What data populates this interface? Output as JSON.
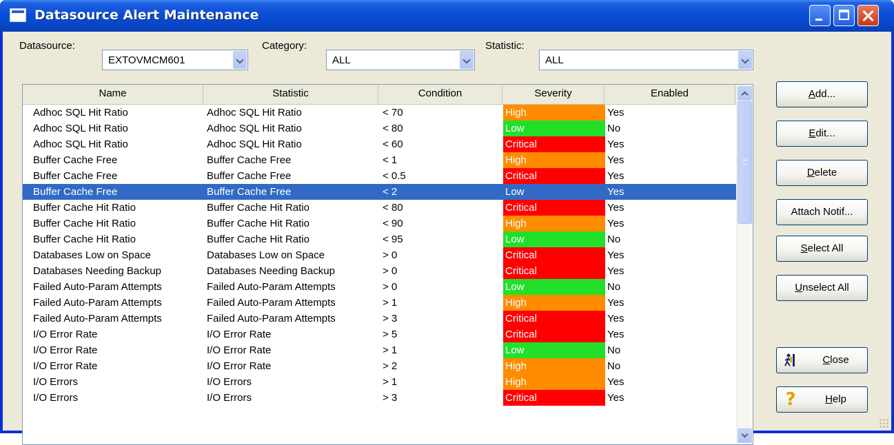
{
  "window": {
    "title": "Datasource Alert Maintenance"
  },
  "filters": {
    "datasource_label": "Datasource:",
    "datasource_value": "EXTOVMCM601",
    "category_label": "Category:",
    "category_value": "ALL",
    "statistic_label": "Statistic:",
    "statistic_value": "ALL"
  },
  "columns": [
    "Name",
    "Statistic",
    "Condition",
    "Severity",
    "Enabled"
  ],
  "rows": [
    {
      "name": "Adhoc SQL Hit Ratio",
      "statistic": "Adhoc SQL Hit Ratio",
      "condition": "< 70",
      "severity": "High",
      "enabled": "Yes"
    },
    {
      "name": "Adhoc SQL Hit Ratio",
      "statistic": "Adhoc SQL Hit Ratio",
      "condition": "< 80",
      "severity": "Low",
      "enabled": "No"
    },
    {
      "name": "Adhoc SQL Hit Ratio",
      "statistic": "Adhoc SQL Hit Ratio",
      "condition": "< 60",
      "severity": "Critical",
      "enabled": "Yes"
    },
    {
      "name": "Buffer Cache Free",
      "statistic": "Buffer Cache Free",
      "condition": "< 1",
      "severity": "High",
      "enabled": "Yes"
    },
    {
      "name": "Buffer Cache Free",
      "statistic": "Buffer Cache Free",
      "condition": "< 0.5",
      "severity": "Critical",
      "enabled": "Yes"
    },
    {
      "name": "Buffer Cache Free",
      "statistic": "Buffer Cache Free",
      "condition": "< 2",
      "severity": "Low",
      "enabled": "Yes",
      "selected": true
    },
    {
      "name": "Buffer Cache Hit Ratio",
      "statistic": "Buffer Cache Hit Ratio",
      "condition": "< 80",
      "severity": "Critical",
      "enabled": "Yes"
    },
    {
      "name": "Buffer Cache Hit Ratio",
      "statistic": "Buffer Cache Hit Ratio",
      "condition": "< 90",
      "severity": "High",
      "enabled": "Yes"
    },
    {
      "name": "Buffer Cache Hit Ratio",
      "statistic": "Buffer Cache Hit Ratio",
      "condition": "< 95",
      "severity": "Low",
      "enabled": "No"
    },
    {
      "name": "Databases Low on Space",
      "statistic": "Databases Low on Space",
      "condition": "> 0",
      "severity": "Critical",
      "enabled": "Yes"
    },
    {
      "name": "Databases Needing Backup",
      "statistic": "Databases Needing Backup",
      "condition": "> 0",
      "severity": "Critical",
      "enabled": "Yes"
    },
    {
      "name": "Failed Auto-Param Attempts",
      "statistic": "Failed Auto-Param Attempts",
      "condition": "> 0",
      "severity": "Low",
      "enabled": "No"
    },
    {
      "name": "Failed Auto-Param Attempts",
      "statistic": "Failed Auto-Param Attempts",
      "condition": "> 1",
      "severity": "High",
      "enabled": "Yes"
    },
    {
      "name": "Failed Auto-Param Attempts",
      "statistic": "Failed Auto-Param Attempts",
      "condition": "> 3",
      "severity": "Critical",
      "enabled": "Yes"
    },
    {
      "name": "I/O Error Rate",
      "statistic": "I/O Error Rate",
      "condition": "> 5",
      "severity": "Critical",
      "enabled": "Yes"
    },
    {
      "name": "I/O Error Rate",
      "statistic": "I/O Error Rate",
      "condition": "> 1",
      "severity": "Low",
      "enabled": "No"
    },
    {
      "name": "I/O Error Rate",
      "statistic": "I/O Error Rate",
      "condition": "> 2",
      "severity": "High",
      "enabled": "No"
    },
    {
      "name": "I/O Errors",
      "statistic": "I/O Errors",
      "condition": "> 1",
      "severity": "High",
      "enabled": "Yes"
    },
    {
      "name": "I/O Errors",
      "statistic": "I/O Errors",
      "condition": "> 3",
      "severity": "Critical",
      "enabled": "Yes"
    }
  ],
  "buttons": {
    "add": {
      "hot": "A",
      "rest": "dd..."
    },
    "edit": {
      "hot": "E",
      "rest": "dit..."
    },
    "delete": {
      "hot": "D",
      "rest": "elete"
    },
    "attach": {
      "label": "Attach Notif..."
    },
    "select_all": {
      "hot": "S",
      "rest": "elect All"
    },
    "unselect_all": {
      "hot": "U",
      "rest": "nselect All"
    },
    "close": {
      "hot": "C",
      "rest": "lose"
    },
    "help": {
      "hot": "H",
      "rest": "elp"
    }
  },
  "icons": {
    "title": "window-icon",
    "close_btn": "exit-person-icon",
    "help_btn": "question-mark-icon"
  },
  "colors": {
    "High": "#ff8c00",
    "Low": "#22e02a",
    "Critical": "#ff0000",
    "selection": "#316ac5"
  }
}
